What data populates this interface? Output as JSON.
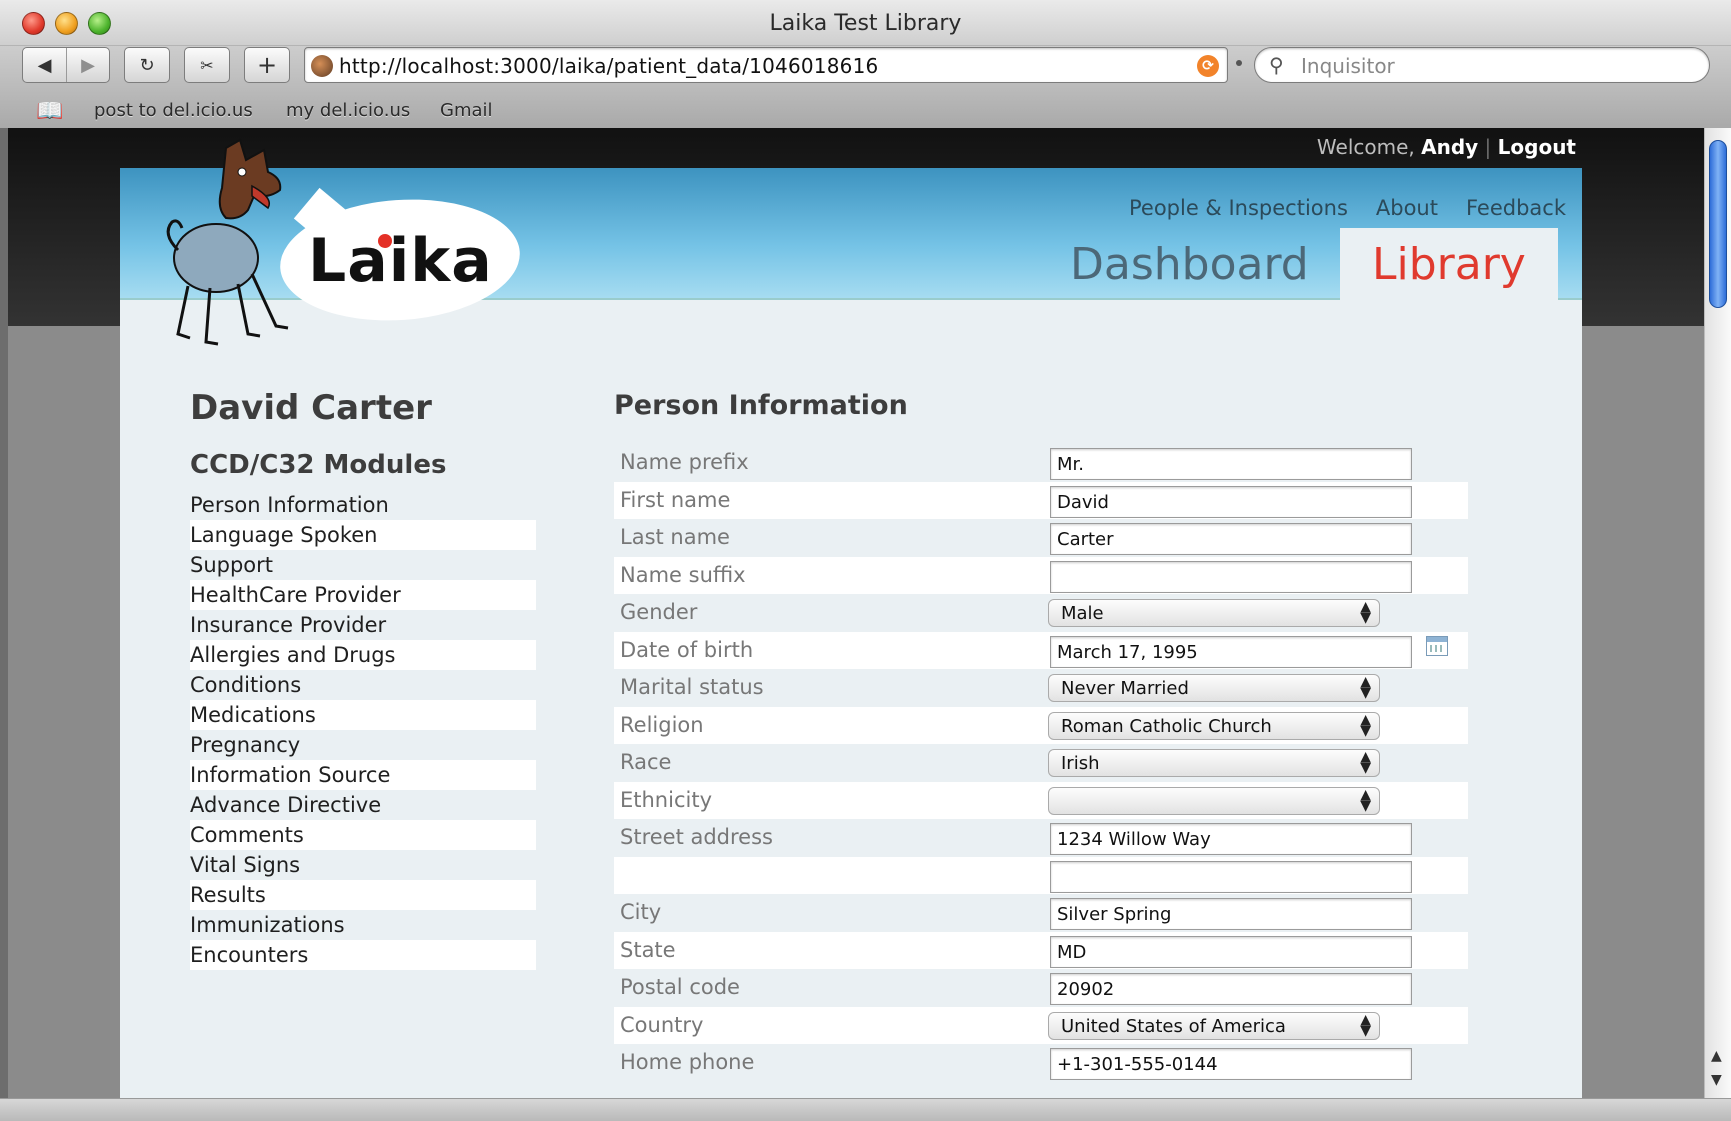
{
  "window": {
    "title": "Laika Test Library"
  },
  "browser": {
    "url": "http://localhost:3000/laika/patient_data/1046018616",
    "search_placeholder": "Inquisitor",
    "bookmarks": [
      "post to del.icio.us",
      "my del.icio.us",
      "Gmail"
    ]
  },
  "user_bar": {
    "welcome": "Welcome,",
    "user": "Andy",
    "separator": "|",
    "logout": "Logout"
  },
  "nav": {
    "people": "People & Inspections",
    "about": "About",
    "feedback": "Feedback"
  },
  "tabs": {
    "dashboard": "Dashboard",
    "library": "Library"
  },
  "logo": {
    "text": "Laika"
  },
  "patient": {
    "name": "David Carter"
  },
  "sidebar": {
    "title": "CCD/C32 Modules",
    "items": [
      "Person Information",
      "Language Spoken",
      "Support",
      "HealthCare Provider",
      "Insurance Provider",
      "Allergies and Drugs",
      "Conditions",
      "Medications",
      "Pregnancy",
      "Information Source",
      "Advance Directive",
      "Comments",
      "Vital Signs",
      "Results",
      "Immunizations",
      "Encounters"
    ]
  },
  "form": {
    "title": "Person Information",
    "fields": {
      "name_prefix": {
        "label": "Name prefix",
        "value": "Mr."
      },
      "first_name": {
        "label": "First name",
        "value": "David"
      },
      "last_name": {
        "label": "Last name",
        "value": "Carter"
      },
      "name_suffix": {
        "label": "Name suffix",
        "value": ""
      },
      "gender": {
        "label": "Gender",
        "value": "Male"
      },
      "date_of_birth": {
        "label": "Date of birth",
        "value": "March 17, 1995"
      },
      "marital_status": {
        "label": "Marital status",
        "value": "Never Married"
      },
      "religion": {
        "label": "Religion",
        "value": "Roman Catholic Church"
      },
      "race": {
        "label": "Race",
        "value": "Irish"
      },
      "ethnicity": {
        "label": "Ethnicity",
        "value": ""
      },
      "street_address": {
        "label": "Street address",
        "value": "1234 Willow Way"
      },
      "street_address_2": {
        "label": "",
        "value": ""
      },
      "city": {
        "label": "City",
        "value": "Silver Spring"
      },
      "state": {
        "label": "State",
        "value": "MD"
      },
      "postal_code": {
        "label": "Postal code",
        "value": "20902"
      },
      "country": {
        "label": "Country",
        "value": "United States of America"
      },
      "home_phone": {
        "label": "Home phone",
        "value": "+1-301-555-0144"
      }
    }
  }
}
